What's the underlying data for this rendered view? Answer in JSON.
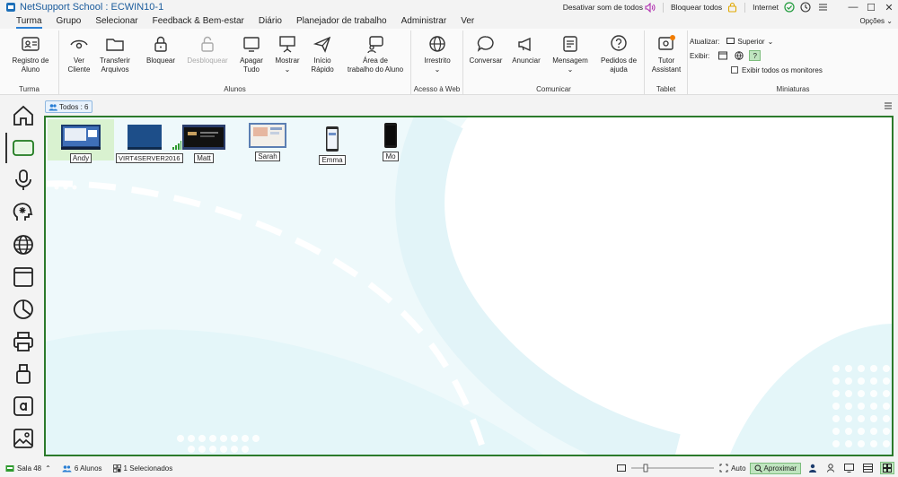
{
  "window": {
    "title": "NetSupport School : ECWIN10-1",
    "mute_all": "Desativar som de todos",
    "lock_all": "Bloquear todos",
    "internet": "Internet"
  },
  "menu": {
    "items": [
      "Turma",
      "Grupo",
      "Selecionar",
      "Feedback & Bem-estar",
      "Diário",
      "Planejador de trabalho",
      "Administrar",
      "Ver"
    ],
    "options": "Opções"
  },
  "ribbon": {
    "turma": {
      "label": "Turma",
      "registro": [
        "Registro de",
        "Aluno"
      ]
    },
    "alunos": {
      "label": "Alunos",
      "ver_cliente": [
        "Ver",
        "Cliente"
      ],
      "transferir": [
        "Transferir",
        "Arquivos"
      ],
      "bloquear": "Bloquear",
      "desbloquear": "Desbloquear",
      "apagar": [
        "Apagar",
        "Tudo"
      ],
      "mostrar": "Mostrar",
      "inicio": [
        "Início",
        "Rápido"
      ],
      "area": [
        "Área de",
        "trabalho do Aluno"
      ]
    },
    "web": {
      "label": "Acesso à Web",
      "irrestrito": "Irrestrito"
    },
    "comunicar": {
      "label": "Comunicar",
      "conversar": "Conversar",
      "anunciar": "Anunciar",
      "mensagem": "Mensagem",
      "pedidos": [
        "Pedidos de",
        "ajuda"
      ]
    },
    "tablet": {
      "label": "Tablet",
      "tutor": [
        "Tutor",
        "Assistant"
      ]
    },
    "miniaturas": {
      "label": "Miniaturas",
      "atualizar": "Atualizar:",
      "atualizar_value": "Superior",
      "exibir": "Exibir:",
      "exibir_todos": "Exibir todos os monitores"
    }
  },
  "tabs": {
    "todos": "Todos : 6"
  },
  "students": [
    {
      "name": "Andy"
    },
    {
      "name": "VIRT4SERVER2016"
    },
    {
      "name": "Matt"
    },
    {
      "name": "Sarah"
    },
    {
      "name": "Emma"
    },
    {
      "name": "Mo"
    }
  ],
  "status": {
    "room": "Sala 48",
    "students": "6 Alunos",
    "selected": "1 Selecionados",
    "auto": "Auto",
    "zoom": "Aproximar"
  },
  "colors": {
    "accent": "#2a7fd4",
    "canvas_border": "#2b7a2b",
    "selected_bg": "#d9f2d0",
    "zoom_bg": "#bfe5bf"
  }
}
